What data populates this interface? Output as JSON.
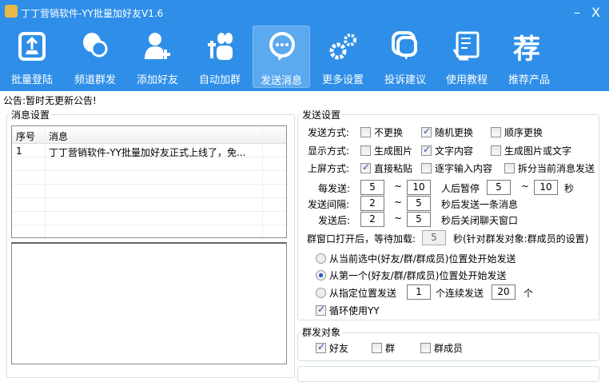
{
  "window": {
    "title": "丁丁营销软件-YY批量加好友V1.6",
    "minimize": "–",
    "close": "X"
  },
  "toolbar": [
    {
      "label": "批量登陆",
      "icon": "upload-icon"
    },
    {
      "label": "频道群发",
      "icon": "chat-bubbles-icon"
    },
    {
      "label": "添加好友",
      "icon": "add-user-icon"
    },
    {
      "label": "自动加群",
      "icon": "add-group-icon"
    },
    {
      "label": "发送消息",
      "icon": "message-icon",
      "active": true
    },
    {
      "label": "更多设置",
      "icon": "gears-icon"
    },
    {
      "label": "投诉建议",
      "icon": "feedback-icon"
    },
    {
      "label": "使用教程",
      "icon": "tutorial-icon"
    },
    {
      "label": "推荐产品",
      "icon": "recommend-icon",
      "glyph": "荐"
    }
  ],
  "notice": "公告:暂时无更新公告!",
  "message_settings": {
    "legend": "消息设置",
    "columns": [
      "序号",
      "消息"
    ],
    "rows": [
      [
        "1",
        "丁丁营销软件-YY批量加好友正式上线了，免..."
      ]
    ]
  },
  "send_settings": {
    "legend": "发送设置",
    "send_mode": {
      "label": "发送方式:",
      "options": [
        {
          "label": "不更换",
          "checked": false
        },
        {
          "label": "随机更换",
          "checked": true
        },
        {
          "label": "顺序更换",
          "checked": false
        }
      ]
    },
    "display_mode": {
      "label": "显示方式:",
      "options": [
        {
          "label": "生成图片",
          "checked": false
        },
        {
          "label": "文字内容",
          "checked": true
        },
        {
          "label": "生成图片或文字",
          "checked": false
        }
      ]
    },
    "screen_mode": {
      "label": "上屏方式:",
      "options": [
        {
          "label": "直接粘贴",
          "checked": true
        },
        {
          "label": "逐字输入内容",
          "checked": false
        },
        {
          "label": "拆分当前消息发送",
          "checked": false
        }
      ]
    },
    "per_send": {
      "label": "每发送:",
      "min": "5",
      "max": "10",
      "mid": "人后暂停",
      "pause_min": "5",
      "pause_max": "10",
      "unit": "秒"
    },
    "interval": {
      "label": "发送间隔:",
      "min": "2",
      "max": "5",
      "suffix": "秒后发送一条消息"
    },
    "after_send": {
      "label": "发送后:",
      "min": "2",
      "max": "5",
      "suffix": "秒后关闭聊天窗口"
    },
    "wait_load": {
      "label": "群窗口打开后，等待加载:",
      "value": "5",
      "suffix": "秒(针对群发对象:群成员的设置)"
    },
    "tilde": "~",
    "start_options": [
      {
        "label": "从当前选中(好友/群/群成员)位置处开始发送",
        "selected": false
      },
      {
        "label": "从第一个(好友/群/群成员)位置处开始发送",
        "selected": true
      },
      {
        "label": "从指定位置发送",
        "selected": false,
        "start": "1",
        "mid": "个连续发送",
        "count": "20",
        "unit": "个"
      }
    ],
    "loop": {
      "label": "循环使用YY",
      "checked": true
    }
  },
  "targets": {
    "legend": "群发对象",
    "options": [
      {
        "label": "好友",
        "checked": true
      },
      {
        "label": "群",
        "checked": false
      },
      {
        "label": "群成员",
        "checked": false
      }
    ]
  }
}
